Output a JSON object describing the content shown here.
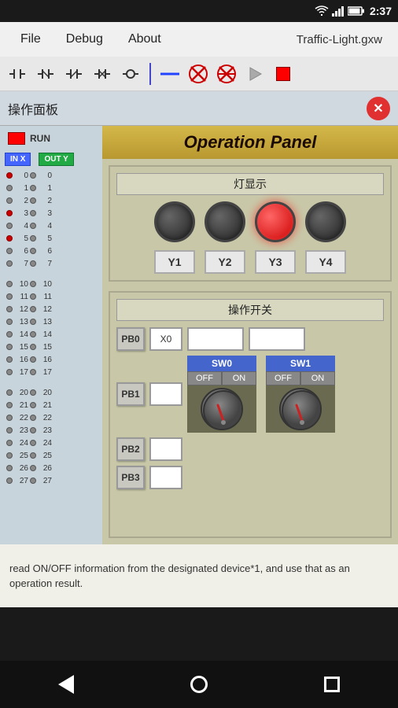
{
  "statusBar": {
    "time": "2:37",
    "icons": [
      "wifi",
      "signal",
      "battery"
    ]
  },
  "menuBar": {
    "items": [
      "File",
      "Debug",
      "About"
    ],
    "title": "Traffic-Light.gxw"
  },
  "toolbar": {
    "buttons": [
      "nc-contact",
      "nc-contact-2",
      "nc-contact-3",
      "nc-contact-4",
      "coil"
    ],
    "divider": true,
    "lineBtn": "—",
    "xBtn": "✕",
    "xBtn2": "✕",
    "playBtn": "▶",
    "stopBtn": "■"
  },
  "dialog": {
    "title": "操作面板",
    "closeBtn": "✕"
  },
  "sidebar": {
    "runLabel": "RUN",
    "inLabel": "IN X",
    "outLabel": "OUT Y",
    "ioRows": [
      {
        "num": "0",
        "inActive": true,
        "outActive": false
      },
      {
        "num": "1",
        "inActive": false,
        "outActive": false
      },
      {
        "num": "2",
        "inActive": false,
        "outActive": false
      },
      {
        "num": "3",
        "inActive": true,
        "outActive": false
      },
      {
        "num": "4",
        "inActive": false,
        "outActive": false
      },
      {
        "num": "5",
        "inActive": true,
        "outActive": false
      },
      {
        "num": "6",
        "inActive": false,
        "outActive": false
      },
      {
        "num": "7",
        "inActive": false,
        "outActive": false
      }
    ],
    "ioRows2": [
      {
        "num": "10",
        "inActive": false,
        "outActive": false
      },
      {
        "num": "11",
        "inActive": false,
        "outActive": false
      },
      {
        "num": "12",
        "inActive": false,
        "outActive": false
      },
      {
        "num": "13",
        "inActive": false,
        "outActive": false
      },
      {
        "num": "14",
        "inActive": false,
        "outActive": false
      },
      {
        "num": "15",
        "inActive": false,
        "outActive": false
      },
      {
        "num": "16",
        "inActive": false,
        "outActive": false
      },
      {
        "num": "17",
        "inActive": false,
        "outActive": false
      }
    ],
    "ioRows3": [
      {
        "num": "20",
        "inActive": false,
        "outActive": false
      },
      {
        "num": "21",
        "inActive": false,
        "outActive": false
      },
      {
        "num": "22",
        "inActive": false,
        "outActive": false
      },
      {
        "num": "23",
        "inActive": false,
        "outActive": false
      },
      {
        "num": "24",
        "inActive": false,
        "outActive": false
      },
      {
        "num": "25",
        "inActive": false,
        "outActive": false
      },
      {
        "num": "26",
        "inActive": false,
        "outActive": false
      },
      {
        "num": "27",
        "inActive": false,
        "outActive": false
      }
    ]
  },
  "operationPanel": {
    "title": "Operation Panel",
    "lightSection": {
      "title": "灯显示",
      "lights": [
        {
          "id": "Y1",
          "active": false
        },
        {
          "id": "Y2",
          "active": false
        },
        {
          "id": "Y3",
          "active": true
        },
        {
          "id": "Y4",
          "active": false
        }
      ]
    },
    "switchSection": {
      "title": "操作开关",
      "pb0": {
        "label": "PB0",
        "input": "X0"
      },
      "pb1": {
        "label": "PB1"
      },
      "pb2": {
        "label": "PB2"
      },
      "pb3": {
        "label": "PB3"
      },
      "sw0": {
        "label": "SW0",
        "offLabel": "OFF",
        "onLabel": "ON"
      },
      "sw1": {
        "label": "SW1",
        "offLabel": "OFF",
        "onLabel": "ON"
      }
    }
  },
  "bottomText": "read ON/OFF information from the designated device*1, and use that as an operation result.",
  "navBar": {
    "back": "◀",
    "home": "●",
    "square": "■"
  }
}
